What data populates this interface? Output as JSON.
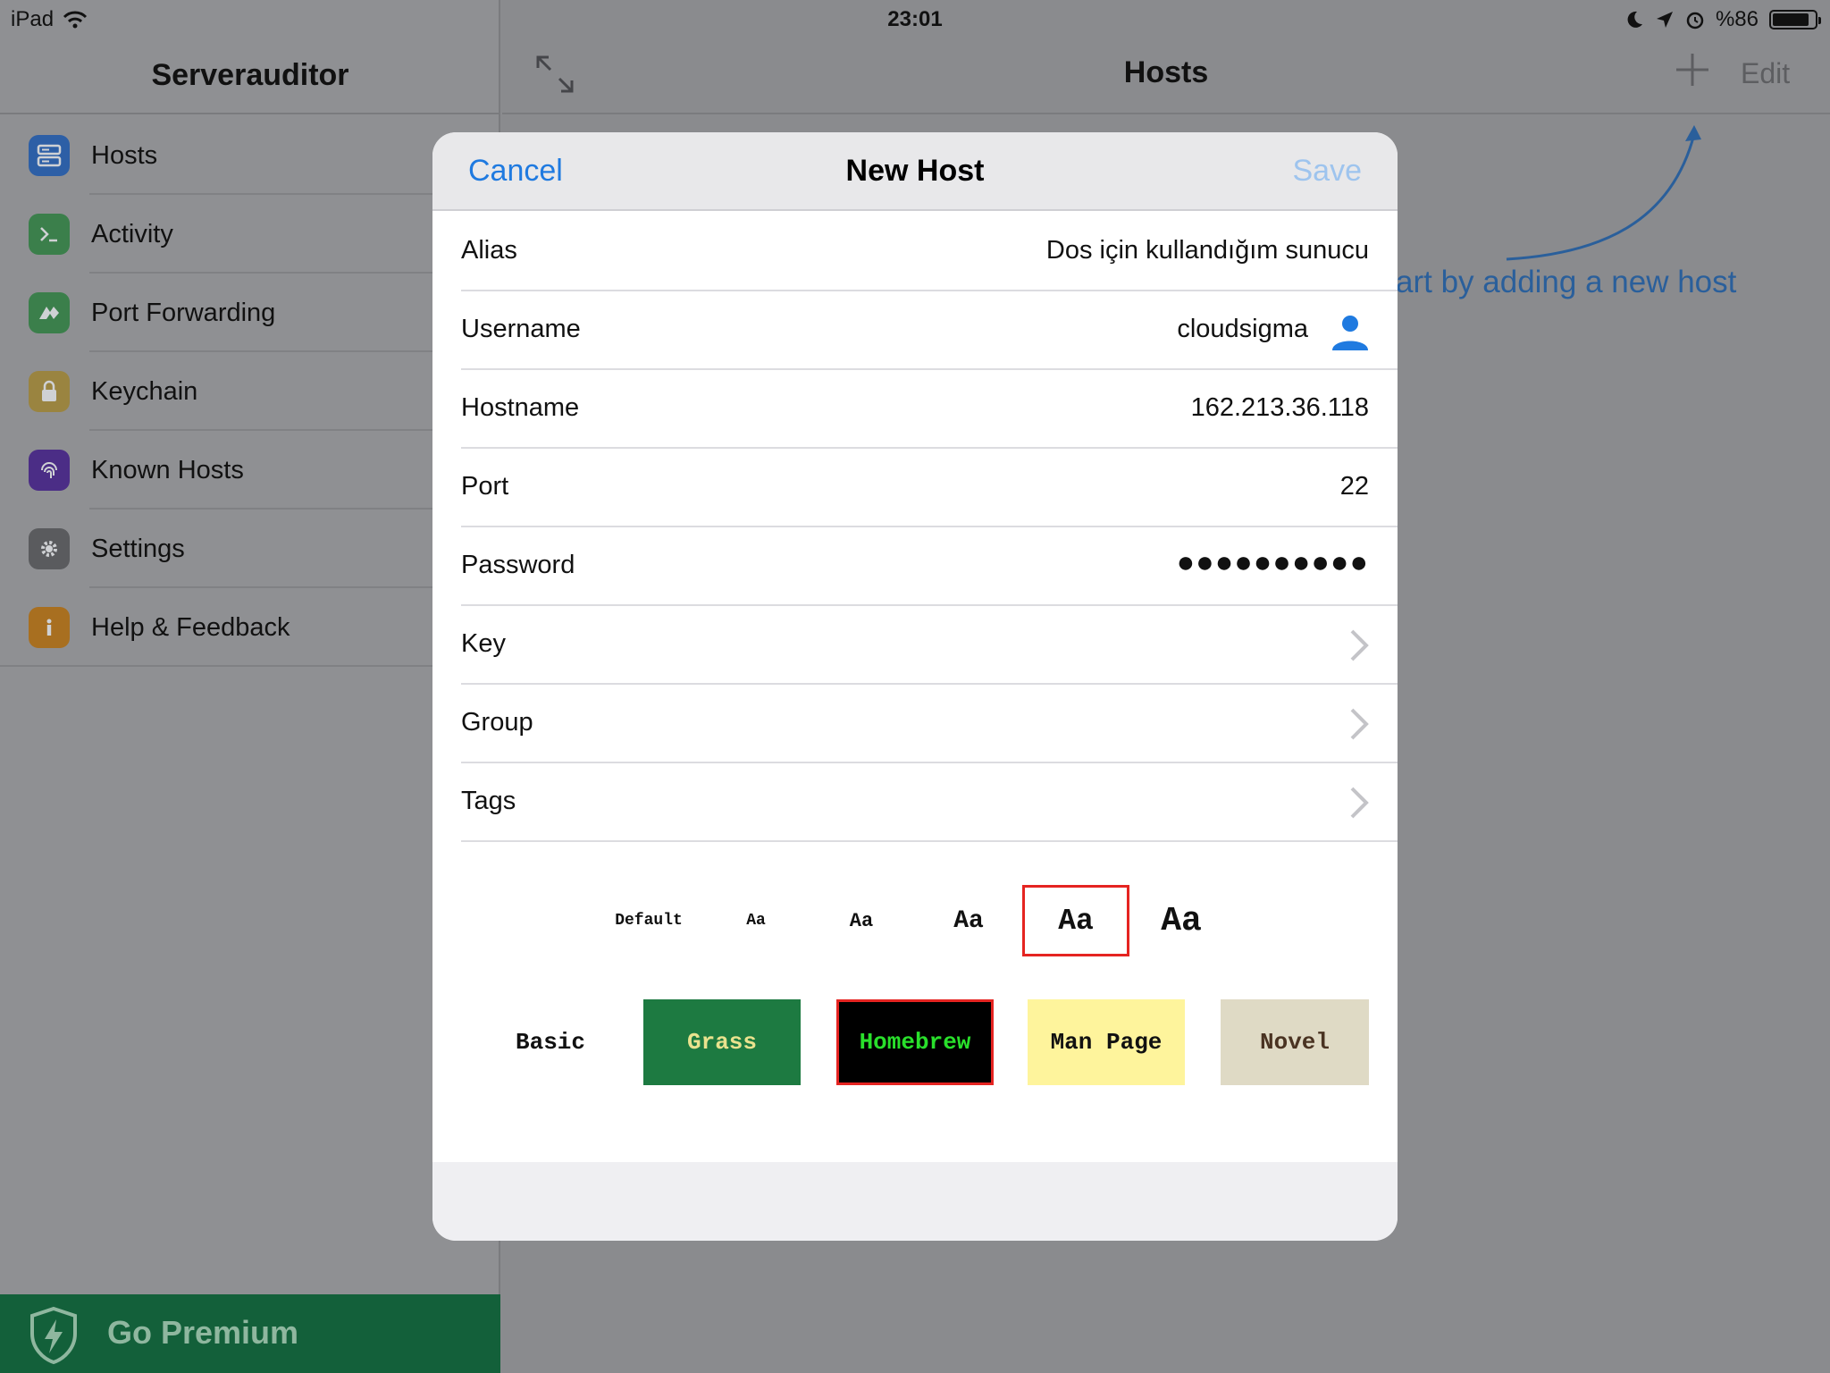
{
  "status_bar": {
    "device": "iPad",
    "time": "23:01",
    "battery_text": "%86",
    "battery_level": 0.86
  },
  "sidebar": {
    "title": "Serverauditor",
    "items": [
      {
        "label": "Hosts",
        "icon": "server-icon",
        "color": "#2d6fcf"
      },
      {
        "label": "Activity",
        "icon": "terminal-icon",
        "color": "#3d9a4f"
      },
      {
        "label": "Port Forwarding",
        "icon": "port-forwarding-icon",
        "color": "#3d9a4f"
      },
      {
        "label": "Keychain",
        "icon": "lock-icon",
        "color": "#b69a3a"
      },
      {
        "label": "Known Hosts",
        "icon": "fingerprint-icon",
        "color": "#5a2ba0"
      },
      {
        "label": "Settings",
        "icon": "gear-icon",
        "color": "#5f6063"
      },
      {
        "label": "Help & Feedback",
        "icon": "info-icon",
        "color": "#c3801a"
      }
    ],
    "premium_label": "Go Premium"
  },
  "main": {
    "title": "Hosts",
    "edit_label": "Edit",
    "hint": "art by adding a new host"
  },
  "modal": {
    "cancel_label": "Cancel",
    "title": "New Host",
    "save_label": "Save",
    "fields": {
      "alias": {
        "label": "Alias",
        "value": "Dos için kullandığım sunucu"
      },
      "username": {
        "label": "Username",
        "value": "cloudsigma"
      },
      "hostname": {
        "label": "Hostname",
        "value": "162.213.36.118"
      },
      "port": {
        "label": "Port",
        "value": "22"
      },
      "password": {
        "label": "Password",
        "value": "●●●●●●●●●●"
      },
      "key": {
        "label": "Key"
      },
      "group": {
        "label": "Group"
      },
      "tags": {
        "label": "Tags"
      }
    },
    "font_sizes": {
      "default": "Default",
      "size1": "Aa",
      "size2": "Aa",
      "size3": "Aa",
      "size4": "Aa",
      "size5": "Aa"
    },
    "themes": {
      "basic": "Basic",
      "grass": "Grass",
      "homebrew": "Homebrew",
      "manpage": "Man Page",
      "novel": "Novel"
    }
  },
  "colors": {
    "accent": "#1f7ae0",
    "selected_border": "#e52421",
    "grass_bg": "#1d7a41",
    "grass_fg": "#e9e28e",
    "homebrew_bg": "#000000",
    "homebrew_fg": "#29e02b",
    "manpage_bg": "#fef49c",
    "novel_bg": "#dfdac5",
    "novel_fg": "#4a3322"
  }
}
